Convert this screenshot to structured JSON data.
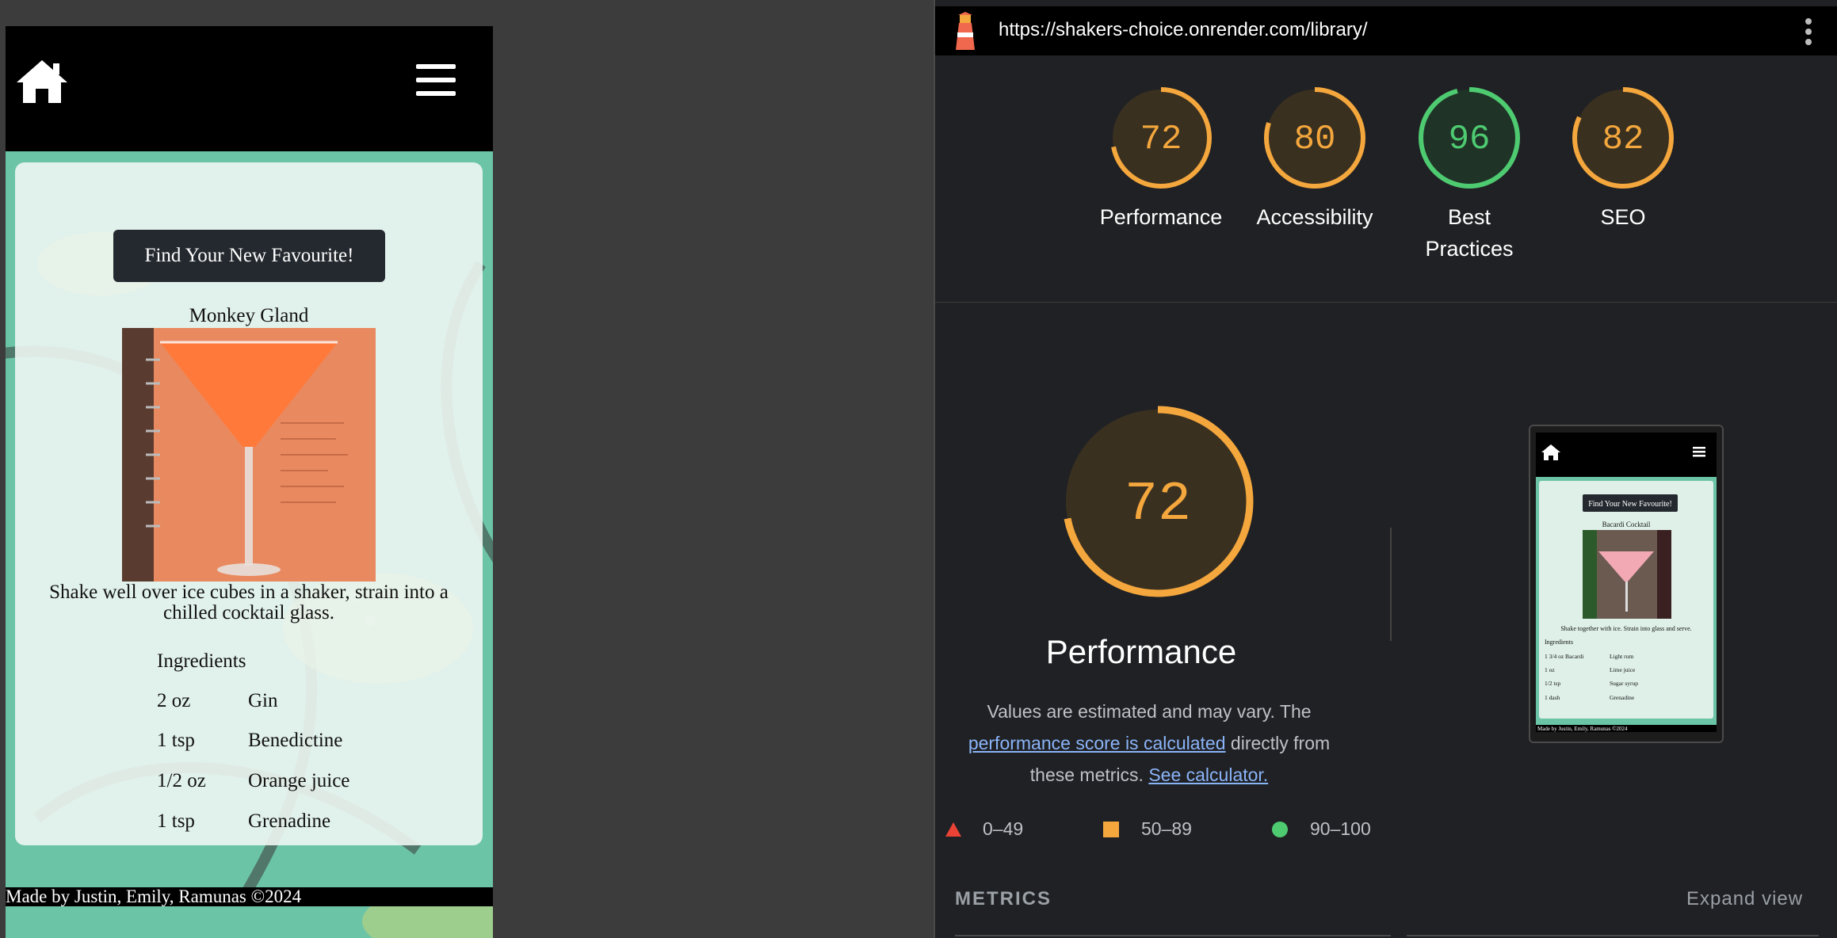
{
  "mobile": {
    "icons": {
      "home": "home-icon",
      "menu": "hamburger-menu-icon"
    },
    "find_button": "Find Your New Favourite!",
    "drink": {
      "name": "Monkey Gland",
      "method": "Shake well over ice cubes in a shaker, strain into a chilled cocktail glass.",
      "ingredients_heading": "Ingredients",
      "ingredients": [
        {
          "qty": "2 oz",
          "item": "Gin"
        },
        {
          "qty": "1 tsp",
          "item": "Benedictine"
        },
        {
          "qty": "1/2 oz",
          "item": "Orange juice"
        },
        {
          "qty": "1 tsp",
          "item": "Grenadine"
        }
      ]
    },
    "footer": "Made by Justin, Emily, Ramunas ©2024",
    "colors": {
      "header": "#000000",
      "page_bg": "#6cc4a6",
      "button": "#24292f"
    }
  },
  "lighthouse": {
    "url": "https://shakers-choice.onrender.com/library/",
    "scores": [
      {
        "label": "Performance",
        "value": 72,
        "color": "#f4a73d"
      },
      {
        "label": "Accessibility",
        "value": 80,
        "color": "#f4a73d"
      },
      {
        "label": "Best Practices",
        "value": 96,
        "color": "#4ecb71"
      },
      {
        "label": "SEO",
        "value": 82,
        "color": "#f4a73d"
      }
    ],
    "featured": {
      "value": 72,
      "label": "Performance",
      "note_pre": "Values are estimated and may vary. The",
      "note_link1": "performance score is calculated",
      "note_mid": "directly from these metrics.",
      "note_link2": "See calculator."
    },
    "legend": [
      {
        "range": "0–49",
        "shape": "triangle",
        "color": "#ea4335"
      },
      {
        "range": "50–89",
        "shape": "square",
        "color": "#f4a73d"
      },
      {
        "range": "90–100",
        "shape": "circle",
        "color": "#4ecb71"
      }
    ],
    "metrics_label": "METRICS",
    "expand_label": "Expand view",
    "thumbnail": {
      "button": "Find Your New Favourite!",
      "drink_name": "Bacardi Cocktail",
      "method": "Shake together with ice. Strain into glass and serve.",
      "ingredients_heading": "Ingredients",
      "ingredients": [
        {
          "qty": "1 3/4 oz Bacardi",
          "item": "Light rum"
        },
        {
          "qty": "1 oz",
          "item": "Lime juice"
        },
        {
          "qty": "1/2 tsp",
          "item": "Sugar syrup"
        },
        {
          "qty": "1 dash",
          "item": "Grenadine"
        }
      ],
      "footer": "Made by Justin, Emily, Ramunas ©2024"
    }
  }
}
